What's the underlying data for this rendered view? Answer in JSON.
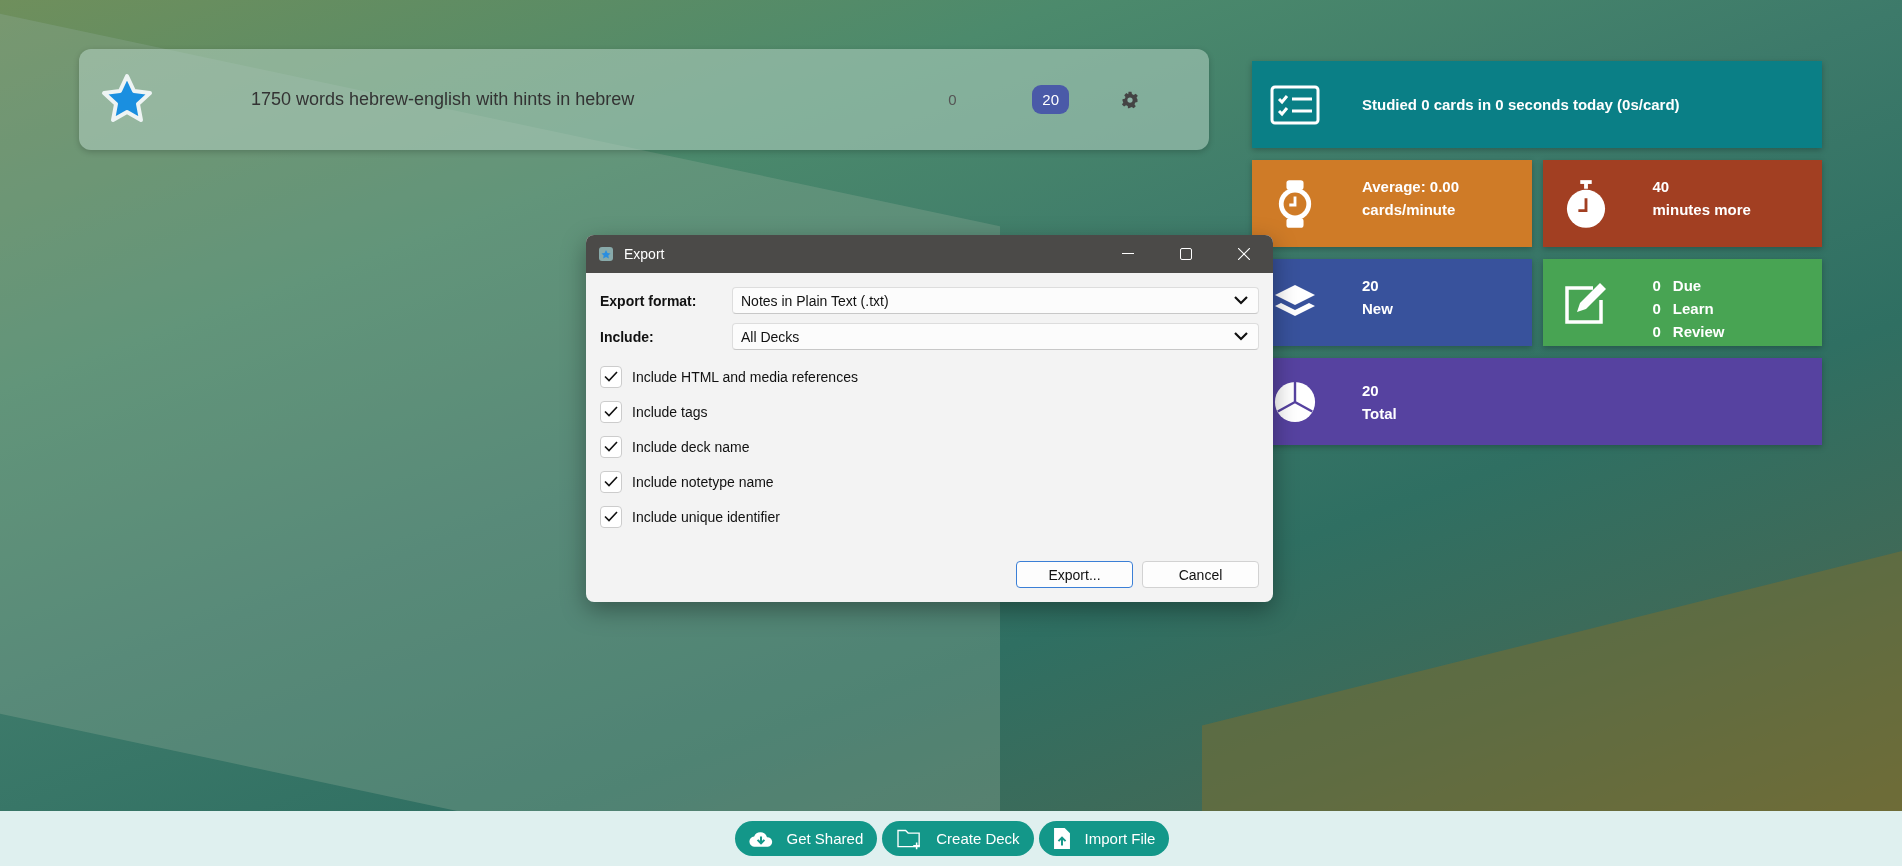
{
  "deck": {
    "name": "1750 words hebrew-english with hints in hebrew",
    "count_1": "0",
    "count_2": "20"
  },
  "stats": [
    {
      "kind": "wide",
      "color": "#0a7f86",
      "lines": [
        "Studied 0 cards in 0 seconds today (0s/card)"
      ]
    },
    {
      "kind": "half",
      "color": "#cf7b27",
      "lines": [
        "Average: 0.00",
        "cards/minute"
      ]
    },
    {
      "kind": "half",
      "color": "#a23f22",
      "lines": [
        "40",
        "minutes more"
      ]
    },
    {
      "kind": "half",
      "color": "#38529c",
      "lines": [
        "20",
        "New"
      ]
    },
    {
      "kind": "counts",
      "color": "#48a453",
      "rows": [
        {
          "count": "0",
          "label": "Due"
        },
        {
          "count": "0",
          "label": "Learn"
        },
        {
          "count": "0",
          "label": "Review"
        }
      ]
    },
    {
      "kind": "wide",
      "color": "#5642a0",
      "lines": [
        "20",
        "Total"
      ]
    }
  ],
  "dialog": {
    "title": "Export",
    "fields": [
      {
        "label": "Export format:",
        "value": "Notes in Plain Text (.txt)"
      },
      {
        "label": "Include:",
        "value": "All Decks"
      }
    ],
    "options": [
      {
        "label": "Include HTML and media references",
        "checked": true
      },
      {
        "label": "Include tags",
        "checked": true
      },
      {
        "label": "Include deck name",
        "checked": true
      },
      {
        "label": "Include notetype name",
        "checked": true
      },
      {
        "label": "Include unique identifier",
        "checked": true
      }
    ],
    "buttons": [
      {
        "label": "Export...",
        "default": true
      },
      {
        "label": "Cancel",
        "default": false
      }
    ]
  },
  "bottom_buttons": [
    "Get Shared",
    "Create Deck",
    "Import File"
  ]
}
